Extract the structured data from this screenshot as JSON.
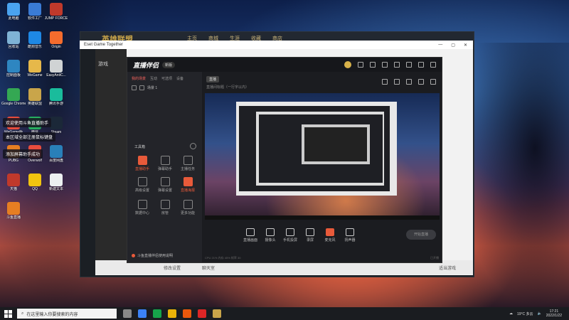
{
  "desktop": {
    "icons": [
      {
        "label": "此电脑",
        "color": "#4aa3f0"
      },
      {
        "label": "软件工厂",
        "color": "#3a7bd5"
      },
      {
        "label": "JUMP FORCE",
        "color": "#c0392b"
      },
      {
        "label": "回收站",
        "color": "#7fb3d5"
      },
      {
        "label": "酷狗音乐",
        "color": "#1e88e5"
      },
      {
        "label": "Origin",
        "color": "#f56c2d"
      },
      {
        "label": "控制面板",
        "color": "#2e86c1"
      },
      {
        "label": "WeGame",
        "color": "#e6b84a"
      },
      {
        "label": "EasyAntiC...",
        "color": "#d0d3d4"
      },
      {
        "label": "Google Chrome",
        "color": "#34a853"
      },
      {
        "label": "英雄联盟",
        "color": "#c9a54a"
      },
      {
        "label": "腾讯手游",
        "color": "#1abc9c"
      },
      {
        "label": "WeGame版",
        "color": "#e74c3c"
      },
      {
        "label": "微信",
        "color": "#27ae60"
      },
      {
        "label": "Steam",
        "color": "#1b2838"
      },
      {
        "label": "PUBG",
        "color": "#e67e22"
      },
      {
        "label": "Overwolf",
        "color": "#e84c3d"
      },
      {
        "label": "百度网盘",
        "color": "#2980b9"
      },
      {
        "label": "天猫",
        "color": "#c0392b"
      },
      {
        "label": "QQ",
        "color": "#f1c40f"
      },
      {
        "label": "新建文本",
        "color": "#ecf0f1"
      },
      {
        "label": "斗鱼直播",
        "color": "#e67e22"
      }
    ],
    "toasts": [
      "欢迎使用斗鱼直播助手",
      "本区域全部注册鼠标键盘",
      "添加屏幕助手成功"
    ]
  },
  "game": {
    "logo": "英雄联盟",
    "nav": [
      "主页",
      "商城",
      "生涯",
      "收藏",
      "商店"
    ]
  },
  "etg": {
    "title": "Eset Game Together",
    "side_label": "游戏",
    "bottom": [
      "修改设置",
      "聊天室"
    ],
    "bottom_right": "适当游戏"
  },
  "app": {
    "logo": "直播伴侣",
    "badge": "新版",
    "tabs": [
      "我的场景",
      "互动",
      "可选项",
      "设备"
    ],
    "scene": "场景 1",
    "tools_header": "工具箱",
    "tools": [
      {
        "label": "直播助手",
        "red": true
      },
      {
        "label": "弹幕助手",
        "red": false
      },
      {
        "label": "主播任务",
        "red": false
      },
      {
        "label": "高级设置",
        "red": false
      },
      {
        "label": "弹幕设置",
        "red": false
      },
      {
        "label": "直播海报",
        "red": true
      },
      {
        "label": "数据中心",
        "red": false
      },
      {
        "label": "房管",
        "red": false
      },
      {
        "label": "更多功能",
        "red": false
      }
    ],
    "notice": "斗鱼直播伴侣使用说明",
    "main_tag": "直播",
    "main_sub": "直播间标题（一行字以内）",
    "controls": [
      {
        "label": "直播画面",
        "red": false
      },
      {
        "label": "摄像头",
        "red": false
      },
      {
        "label": "手机投屏",
        "red": false
      },
      {
        "label": "录屏",
        "red": false
      },
      {
        "label": "麦克风",
        "red": true
      },
      {
        "label": "扬声器",
        "red": false
      }
    ],
    "start_button": "开始直播",
    "status_left": "CPU 21% 内存 45% 帧率 30",
    "status_right": "已开播"
  },
  "taskbar": {
    "search_placeholder": "在这里输入你要搜索的内容",
    "apps": [
      {
        "color": "#888"
      },
      {
        "color": "#3b82f6"
      },
      {
        "color": "#16a34a"
      },
      {
        "color": "#eab308"
      },
      {
        "color": "#ea580c"
      },
      {
        "color": "#dc2626"
      },
      {
        "color": "#c9a54a"
      }
    ],
    "weather": "19°C 多云",
    "time": "17:21",
    "date": "2022/1/22"
  }
}
